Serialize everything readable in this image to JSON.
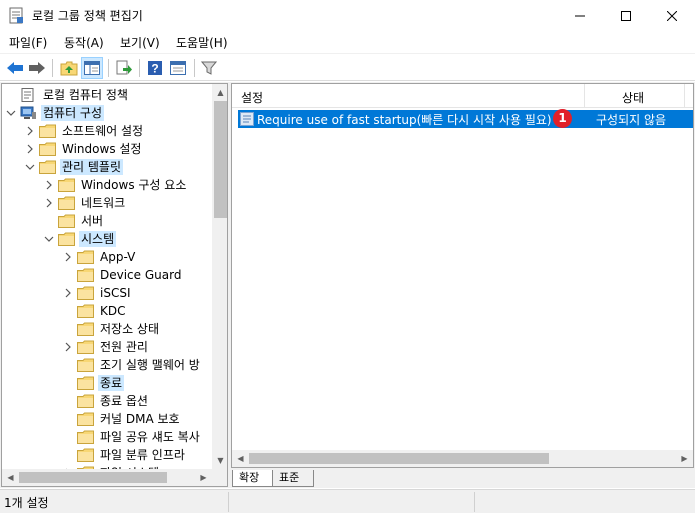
{
  "window": {
    "title": "로컬 그룹 정책 편집기",
    "minimize_glyph": "─",
    "maximize_glyph": "☐",
    "close_glyph": "✕"
  },
  "menu": [
    "파일(F)",
    "동작(A)",
    "보기(V)",
    "도움말(H)"
  ],
  "toolbar": {
    "icons": [
      "back-icon",
      "forward-icon",
      "up-folder-icon",
      "show-hide-tree-icon",
      "export-list-icon",
      "help-icon",
      "properties-icon",
      "filter-icon"
    ]
  },
  "tree": {
    "items": [
      {
        "label": "로컬 컴퓨터 정책",
        "depth": 0,
        "expander": "none",
        "icon": "policy",
        "selected": false
      },
      {
        "label": "컴퓨터 구성",
        "depth": 0,
        "expander": "open",
        "icon": "computer",
        "selected": true
      },
      {
        "label": "소프트웨어 설정",
        "depth": 1,
        "expander": "closed",
        "icon": "folder",
        "selected": false
      },
      {
        "label": "Windows 설정",
        "depth": 1,
        "expander": "closed",
        "icon": "folder",
        "selected": false
      },
      {
        "label": "관리 템플릿",
        "depth": 1,
        "expander": "open",
        "icon": "folder",
        "selected": true
      },
      {
        "label": "Windows 구성 요소",
        "depth": 2,
        "expander": "closed",
        "icon": "folder",
        "selected": false
      },
      {
        "label": "네트워크",
        "depth": 2,
        "expander": "closed",
        "icon": "folder",
        "selected": false
      },
      {
        "label": "서버",
        "depth": 2,
        "expander": "none",
        "icon": "folder",
        "selected": false
      },
      {
        "label": "시스템",
        "depth": 2,
        "expander": "open",
        "icon": "folder",
        "selected": true
      },
      {
        "label": "App-V",
        "depth": 3,
        "expander": "closed",
        "icon": "folder",
        "selected": false
      },
      {
        "label": "Device Guard",
        "depth": 3,
        "expander": "none",
        "icon": "folder",
        "selected": false
      },
      {
        "label": "iSCSI",
        "depth": 3,
        "expander": "closed",
        "icon": "folder",
        "selected": false
      },
      {
        "label": "KDC",
        "depth": 3,
        "expander": "none",
        "icon": "folder",
        "selected": false
      },
      {
        "label": "저장소 상태",
        "depth": 3,
        "expander": "none",
        "icon": "folder",
        "selected": false
      },
      {
        "label": "전원 관리",
        "depth": 3,
        "expander": "closed",
        "icon": "folder",
        "selected": false
      },
      {
        "label": "조기 실행 맬웨어 방",
        "depth": 3,
        "expander": "none",
        "icon": "folder",
        "selected": false
      },
      {
        "label": "종료",
        "depth": 3,
        "expander": "none",
        "icon": "folder",
        "selected": true
      },
      {
        "label": "종료 옵션",
        "depth": 3,
        "expander": "none",
        "icon": "folder",
        "selected": false
      },
      {
        "label": "커널 DMA 보호",
        "depth": 3,
        "expander": "none",
        "icon": "folder",
        "selected": false
      },
      {
        "label": "파일 공유 섀도 복사",
        "depth": 3,
        "expander": "none",
        "icon": "folder",
        "selected": false
      },
      {
        "label": "파일 분류 인프라",
        "depth": 3,
        "expander": "none",
        "icon": "folder",
        "selected": false
      },
      {
        "label": "파일 시스템",
        "depth": 3,
        "expander": "closed",
        "icon": "folder",
        "selected": false
      }
    ]
  },
  "list": {
    "columns": [
      "설정",
      "상태"
    ],
    "rows": [
      {
        "setting": "Require use of fast startup(빠른 다시 시작 사용 필요)",
        "state": "구성되지 않음"
      }
    ],
    "badge": "1"
  },
  "tabs": [
    "확장",
    "표준"
  ],
  "status": "1개 설정",
  "colors": {
    "selection_blue": "#0078d7",
    "tree_highlight": "#cce8ff",
    "badge_red": "#e0202a",
    "folder_yellow": "#f8d775"
  }
}
